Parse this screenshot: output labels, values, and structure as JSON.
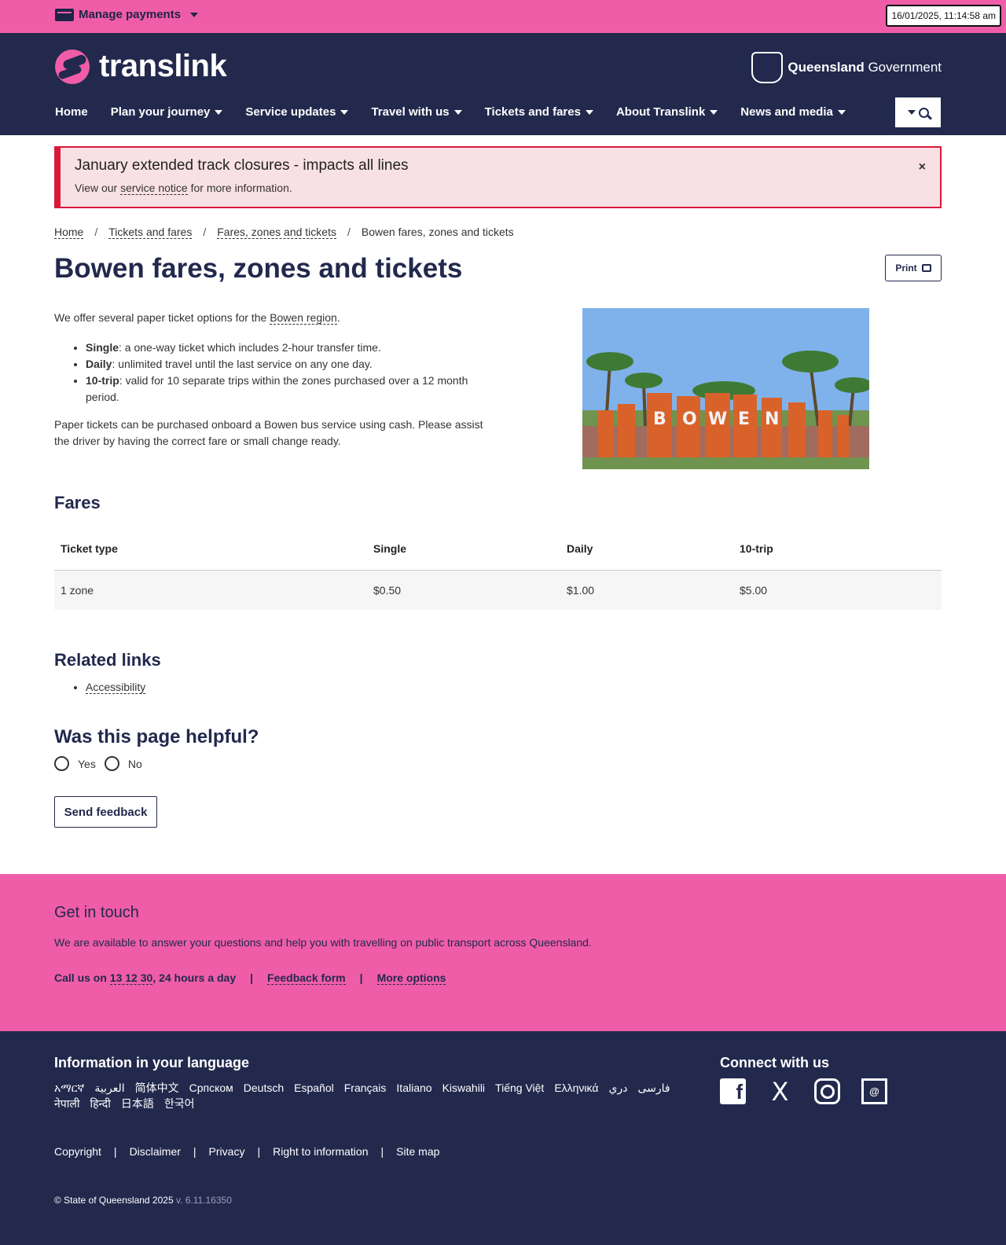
{
  "topbar": {
    "manage_payments": "Manage payments",
    "timestamp": "16/01/2025, 11:14:58 am"
  },
  "header": {
    "logo_text": "translink",
    "gov_bold": "Queensland",
    "gov_rest": " Government",
    "nav": [
      {
        "label": "Home",
        "has_menu": false
      },
      {
        "label": "Plan your journey",
        "has_menu": true
      },
      {
        "label": "Service updates",
        "has_menu": true
      },
      {
        "label": "Travel with us",
        "has_menu": true
      },
      {
        "label": "Tickets and fares",
        "has_menu": true
      },
      {
        "label": "About Translink",
        "has_menu": true
      },
      {
        "label": "News and media",
        "has_menu": true
      }
    ]
  },
  "alert": {
    "title": "January extended track closures - impacts all lines",
    "body_prefix": "View our ",
    "body_link": "service notice",
    "body_suffix": " for more information.",
    "close": "×"
  },
  "breadcrumb": [
    {
      "label": "Home",
      "link": true
    },
    {
      "label": "Tickets and fares",
      "link": true
    },
    {
      "label": "Fares, zones and tickets",
      "link": true
    },
    {
      "label": "Bowen fares, zones and tickets",
      "link": false
    }
  ],
  "page": {
    "title": "Bowen fares, zones and tickets",
    "print_label": "Print",
    "intro_prefix": "We offer several paper ticket options for the ",
    "intro_link": "Bowen region",
    "intro_suffix": ".",
    "tickets": [
      {
        "name": "Single",
        "desc": ": a one-way ticket which includes 2-hour transfer time."
      },
      {
        "name": "Daily",
        "desc": ": unlimited travel until the last service on any one day."
      },
      {
        "name": "10-trip",
        "desc": ": valid for 10 separate trips within the zones purchased over a 12 month period."
      }
    ],
    "purchase_note": "Paper tickets can be purchased onboard a Bowen bus service using cash. Please assist the driver by having the correct fare or small change ready.",
    "sign_text": "BOWEN"
  },
  "fares": {
    "heading": "Fares",
    "columns": [
      "Ticket type",
      "Single",
      "Daily",
      "10-trip"
    ],
    "rows": [
      [
        "1 zone",
        "$0.50",
        "$1.00",
        "$5.00"
      ]
    ]
  },
  "related": {
    "heading": "Related links",
    "links": [
      "Accessibility"
    ]
  },
  "helpful": {
    "heading": "Was this page helpful?",
    "yes": "Yes",
    "no": "No",
    "button": "Send feedback"
  },
  "contact": {
    "heading": "Get in touch",
    "text": "We are available to answer your questions and help you with travelling on public transport across Queensland.",
    "call_prefix": "Call us on ",
    "phone": "13 12 30",
    "call_suffix": ", 24 hours a day",
    "feedback_form": "Feedback form",
    "more_options": "More options"
  },
  "footer": {
    "language_heading": "Information in your language",
    "languages": [
      "አማርኛ",
      "العربية",
      "简体中文",
      "Српском",
      "Deutsch",
      "Español",
      "Français",
      "Italiano",
      "Kiswahili",
      "Tiếng Việt",
      "Ελληνικά",
      "دري",
      "فارسی",
      "नेपाली",
      "हिन्दी",
      "日本語",
      "한국어"
    ],
    "connect_heading": "Connect with us",
    "legal_links": [
      "Copyright",
      "Disclaimer",
      "Privacy",
      "Right to information",
      "Site map"
    ],
    "copyright": "© State of Queensland 2025",
    "version": " v. 6.11.16350"
  },
  "colors": {
    "pink": "#ef5da8",
    "navy": "#22294d",
    "alert_red": "#d9183b",
    "alert_bg": "#f8e1e4"
  }
}
